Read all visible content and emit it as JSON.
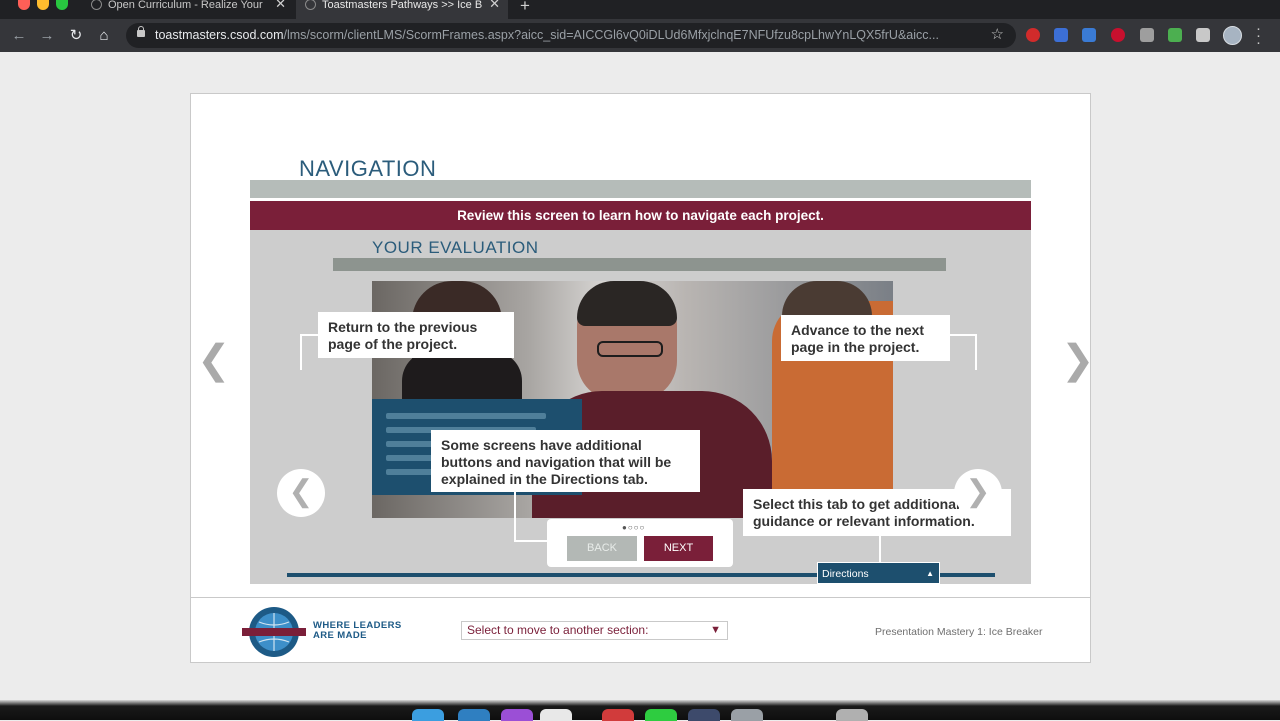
{
  "browser": {
    "tabs": [
      {
        "title": "Open Curriculum - Realize Your",
        "active": false
      },
      {
        "title": "Toastmasters Pathways >> Ice B",
        "active": true
      }
    ],
    "url_host": "toastmasters.csod.com",
    "url_path": "/lms/scorm/clientLMS/ScormFrames.aspx?aicc_sid=AICCGl6vQ0iDLUd6MfxjclnqE7NFUfzu8cpLhwYnLQX5frU&aicc...",
    "close_glyph": "✕",
    "new_tab_glyph": "+",
    "back_glyph": "←",
    "forward_glyph": "→",
    "reload_glyph": "↻",
    "home_glyph": "⌂",
    "star_glyph": "☆",
    "extension_colors": [
      "#d12b2b",
      "#3c6fd6",
      "#3a7bd5",
      "#c8102e",
      "#9e9e9e",
      "#4caf50",
      "#c8c8c8"
    ]
  },
  "course": {
    "section_title": "NAVIGATION",
    "banner": "Review this screen to learn how to navigate each project.",
    "screen": {
      "title": "YOUR EVALUATION",
      "callouts": {
        "previous": "Return to the previous page of the project.",
        "next": "Advance to the next page in the project.",
        "additional": "Some screens have additional buttons and navigation that will be explained in the Directions tab.",
        "tab": "Select this tab to get additional guidance or relevant information."
      },
      "prev_glyph": "❮",
      "next_glyph": "❯",
      "page_dots": "●○○○",
      "back_label": "BACK",
      "next_label": "NEXT",
      "directions_label": "Directions",
      "directions_caret": "▲"
    },
    "outer_prev_glyph": "❮",
    "outer_next_glyph": "❯"
  },
  "footer": {
    "logo_text_line1": "WHERE LEADERS",
    "logo_text_line2": "ARE MADE",
    "section_select_placeholder": "Select to move to another section:",
    "select_caret": "▼",
    "course_name": "Presentation Mastery 1: Ice Breaker"
  },
  "colors": {
    "accent_maroon": "#7a1f39",
    "accent_blue": "#2b5c7b",
    "tab_blue": "#1d4f6e"
  }
}
